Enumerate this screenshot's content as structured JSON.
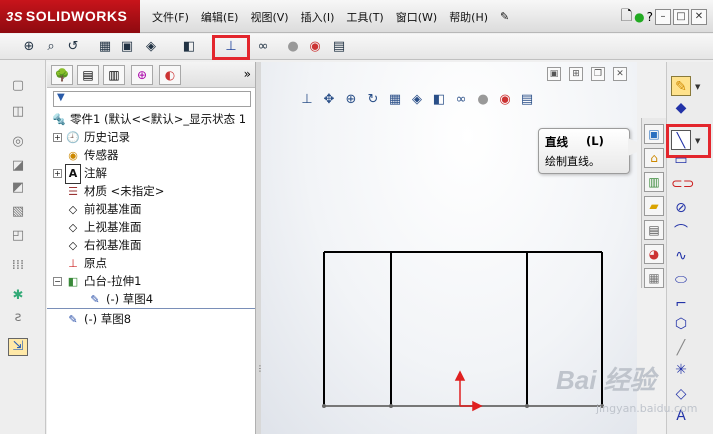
{
  "app": {
    "logo_text": "SOLIDWORKS",
    "logo_prefix": "3S"
  },
  "menu": [
    "文件(F)",
    "编辑(E)",
    "视图(V)",
    "插入(I)",
    "工具(T)",
    "窗口(W)",
    "帮助(H)"
  ],
  "tree": {
    "root": "零件1  (默认<<默认>_显示状态 1",
    "items": [
      {
        "label": "历史记录",
        "icon": "history-icon"
      },
      {
        "label": "传感器",
        "icon": "sensor-icon"
      },
      {
        "label": "注解",
        "icon": "annotation-icon"
      },
      {
        "label": "材质 <未指定>",
        "icon": "material-icon"
      },
      {
        "label": "前视基准面",
        "icon": "plane-icon"
      },
      {
        "label": "上视基准面",
        "icon": "plane-icon"
      },
      {
        "label": "右视基准面",
        "icon": "plane-icon"
      },
      {
        "label": "原点",
        "icon": "origin-icon"
      },
      {
        "label": "凸台-拉伸1",
        "icon": "extrude-icon"
      },
      {
        "label": "(-) 草图4",
        "icon": "sketch-icon"
      },
      {
        "label": "(-) 草图8",
        "icon": "sketch-icon"
      }
    ]
  },
  "tooltip": {
    "title": "直线",
    "shortcut": "(L)",
    "description": "绘制直线。"
  },
  "watermark": {
    "main": "Bai 经验",
    "sub": "jingyan.baidu.com"
  },
  "colors": {
    "highlight": "#e3262d",
    "sketch": "#000000",
    "axis": "#e02020"
  }
}
